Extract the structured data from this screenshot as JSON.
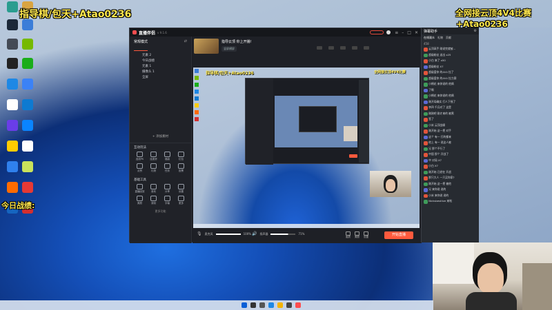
{
  "overlay": {
    "top_left": "指导棋/包天+Atao0236",
    "top_right_1": "全网接云顶4V4比赛",
    "top_right_2": "+Atao0236",
    "left_mid": "今日战绩:"
  },
  "desktop_icons": [
    {
      "label": "",
      "color": "#2a9d8f"
    },
    {
      "label": "",
      "color": "#d9a441"
    },
    {
      "label": "",
      "color": "#1b2838"
    },
    {
      "label": "",
      "color": "#3b7dd8"
    },
    {
      "label": "",
      "color": "#444a55"
    },
    {
      "label": "",
      "color": "#76b900"
    },
    {
      "label": "",
      "color": "#222"
    },
    {
      "label": "",
      "color": "#1aad19"
    },
    {
      "label": "",
      "color": "#1e88e5"
    },
    {
      "label": "",
      "color": "#3b82f6"
    },
    {
      "label": "",
      "color": "#ffffff"
    },
    {
      "label": "",
      "color": "#0e7ad1"
    },
    {
      "label": "",
      "color": "#6a3de8"
    },
    {
      "label": "",
      "color": "#0a84ff"
    },
    {
      "label": "",
      "color": "#ffcc00"
    },
    {
      "label": "",
      "color": "#ffffff"
    },
    {
      "label": "",
      "color": "#2f80ed"
    },
    {
      "label": "",
      "color": "#c9e25b"
    },
    {
      "label": "",
      "color": "#ff6b00"
    },
    {
      "label": "",
      "color": "#e53935"
    },
    {
      "label": "",
      "color": "#1565c0"
    },
    {
      "label": "",
      "color": "#d32f2f"
    }
  ],
  "app": {
    "title": "直播伴侣",
    "version": "v 9.1.6",
    "start_live": "开始直播",
    "stream_title": "指导云顶 你上开播!",
    "mode_label": "竖屏横屏",
    "sidebar_header": "常规模式",
    "sidebar_items": [
      "元素 2",
      "今日战绩",
      "元素 1",
      "摄像头 1",
      "全屏"
    ],
    "add_material": "+ 添加素材",
    "section_interact": "互动玩法",
    "interact_tools": [
      "连线PK",
      "连麦房",
      "福袋",
      "红包",
      "点赞",
      "礼物",
      "任务",
      "投票"
    ],
    "section_basic": "基础工具",
    "basic_tools": [
      "直播回放",
      "音效",
      "分享",
      "设置",
      "美颜",
      "录制",
      "字幕",
      "更多"
    ],
    "more_features": "更多功能",
    "mic_label": "麦克风",
    "speaker_label": "扬声器",
    "mic_value": "100%",
    "speaker_value": "71%",
    "bottom_icons": [
      "画质",
      "美颜",
      "设置"
    ]
  },
  "chat": {
    "header": "弹幕助手",
    "tabs": [
      "在线观众",
      "礼物",
      "贡献"
    ],
    "count": "458",
    "rows": [
      {
        "badge": "",
        "color": "#e2553b",
        "text": "云顶高手 刚说完就被..."
      },
      {
        "badge": "",
        "color": "#3f9c5a",
        "text": "超级粉丝 送出 x25"
      },
      {
        "badge": "",
        "color": "#e2553b",
        "text": "小白 来了 x50"
      },
      {
        "badge": "",
        "color": "#5d6ad6",
        "text": "超级粉丝 X7"
      },
      {
        "badge": "",
        "color": "#e2553b",
        "text": "超级爱你 的4V4 拉了"
      },
      {
        "badge": "",
        "color": "#3f9c5a",
        "text": "超级爱你 的4V4 拉力赛"
      },
      {
        "badge": "",
        "color": "#3f9c5a",
        "text": "小棉花 来你说的 他俩"
      },
      {
        "badge": "",
        "color": "#5d6ad6",
        "text": "了啊"
      },
      {
        "badge": "",
        "color": "#3f9c5a",
        "text": "小棉花 来你说的 他俩"
      },
      {
        "badge": "",
        "color": "#5d6ad6",
        "text": "刚开局确实 打人下摇了"
      },
      {
        "badge": "",
        "color": "#e2553b",
        "text": "李四 千兵对了 这是"
      },
      {
        "badge": "",
        "color": "#3f9c5a",
        "text": "刚刚吧 刚才来的 被黑"
      },
      {
        "badge": "",
        "color": "#e2553b",
        "text": "签了"
      },
      {
        "badge": "",
        "color": "#3f9c5a",
        "text": "小米 云顶战绩"
      },
      {
        "badge": "",
        "color": "#e2553b",
        "text": "刚开始 这一把 对手"
      },
      {
        "badge": "",
        "color": "#5d6ad6",
        "text": "这个 有一 打的都来"
      },
      {
        "badge": "",
        "color": "#e2553b",
        "text": "他上 有一 说这人被"
      },
      {
        "badge": "",
        "color": "#3f9c5a",
        "text": "兄 那个不行了"
      },
      {
        "badge": "",
        "color": "#e2553b",
        "text": "中国 那个 开战了"
      },
      {
        "badge": "",
        "color": "#5d6ad6",
        "text": "中 对局 X7"
      },
      {
        "badge": "",
        "color": "#e2553b",
        "text": "小白 X7"
      },
      {
        "badge": "",
        "color": "#3f9c5a",
        "text": "刚开始 已经在 开战"
      },
      {
        "badge": "",
        "color": "#e2553b",
        "text": "那只大人 一只买你家?"
      },
      {
        "badge": "",
        "color": "#3f9c5a",
        "text": "刚开始 这一把 被他"
      },
      {
        "badge": "",
        "color": "#5d6ad6",
        "text": "兄 来你说 说的"
      },
      {
        "badge": "",
        "color": "#e2553b",
        "text": "小米 来你说 说的"
      },
      {
        "badge": "",
        "color": "#3f9c5a",
        "text": "Nicksbestlive 来啦"
      }
    ]
  },
  "taskbar_icons": [
    "start",
    "search",
    "task-view",
    "browser",
    "explorer",
    "obs",
    "app"
  ]
}
